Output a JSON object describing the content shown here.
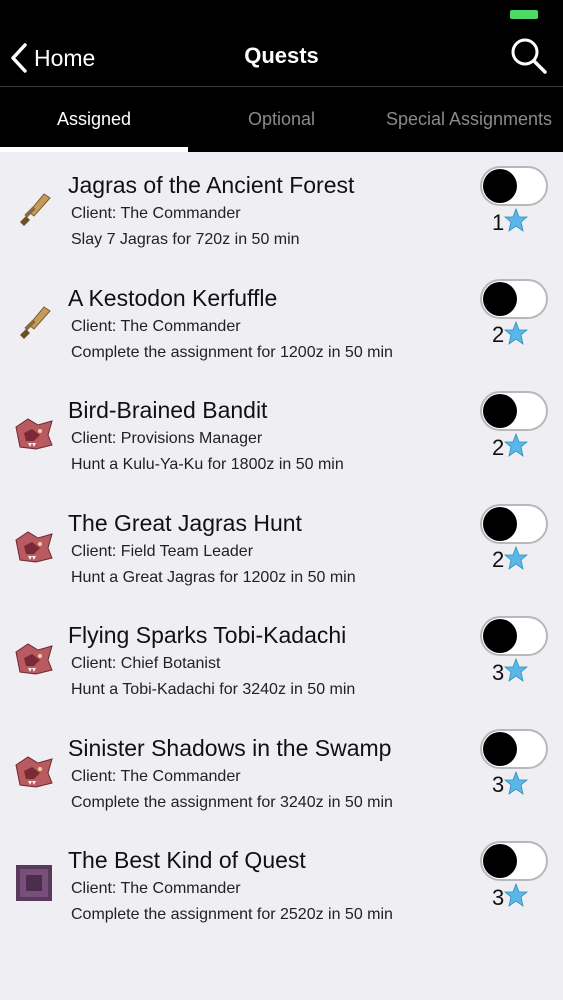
{
  "header": {
    "back_label": "Home",
    "title": "Quests"
  },
  "tabs": [
    {
      "label": "Assigned",
      "active": true
    },
    {
      "label": "Optional",
      "active": false
    },
    {
      "label": "Special Assignments",
      "active": false
    }
  ],
  "quests": [
    {
      "icon": "sword-icon",
      "title": "Jagras of the Ancient Forest",
      "client": "Client: The Commander",
      "description": "Slay 7 Jagras for 720z in 50 min",
      "rank": "1",
      "enabled": false
    },
    {
      "icon": "sword-icon",
      "title": "A Kestodon Kerfuffle",
      "client": "Client: The Commander",
      "description": "Complete the assignment for 1200z in 50 min",
      "rank": "2",
      "enabled": false
    },
    {
      "icon": "monster-icon",
      "title": "Bird-Brained Bandit",
      "client": "Client: Provisions Manager",
      "description": "Hunt a Kulu-Ya-Ku for 1800z in 50 min",
      "rank": "2",
      "enabled": false
    },
    {
      "icon": "monster-icon",
      "title": "The Great Jagras Hunt",
      "client": "Client: Field Team Leader",
      "description": "Hunt a Great Jagras for 1200z in 50 min",
      "rank": "2",
      "enabled": false
    },
    {
      "icon": "monster-icon",
      "title": "Flying Sparks Tobi-Kadachi",
      "client": "Client: Chief Botanist",
      "description": "Hunt a Tobi-Kadachi for 3240z in 50 min",
      "rank": "3",
      "enabled": false
    },
    {
      "icon": "monster-icon",
      "title": "Sinister Shadows in the Swamp",
      "client": "Client: The Commander",
      "description": "Complete the assignment for 3240z in 50 min",
      "rank": "3",
      "enabled": false
    },
    {
      "icon": "item-box-icon",
      "title": "The Best Kind of Quest",
      "client": "Client: The Commander",
      "description": "Complete the assignment for 2520z in 50 min",
      "rank": "3",
      "enabled": false
    }
  ],
  "colors": {
    "star": "#5ab8e8",
    "battery": "#4cd964",
    "background": "#eeeef3"
  }
}
